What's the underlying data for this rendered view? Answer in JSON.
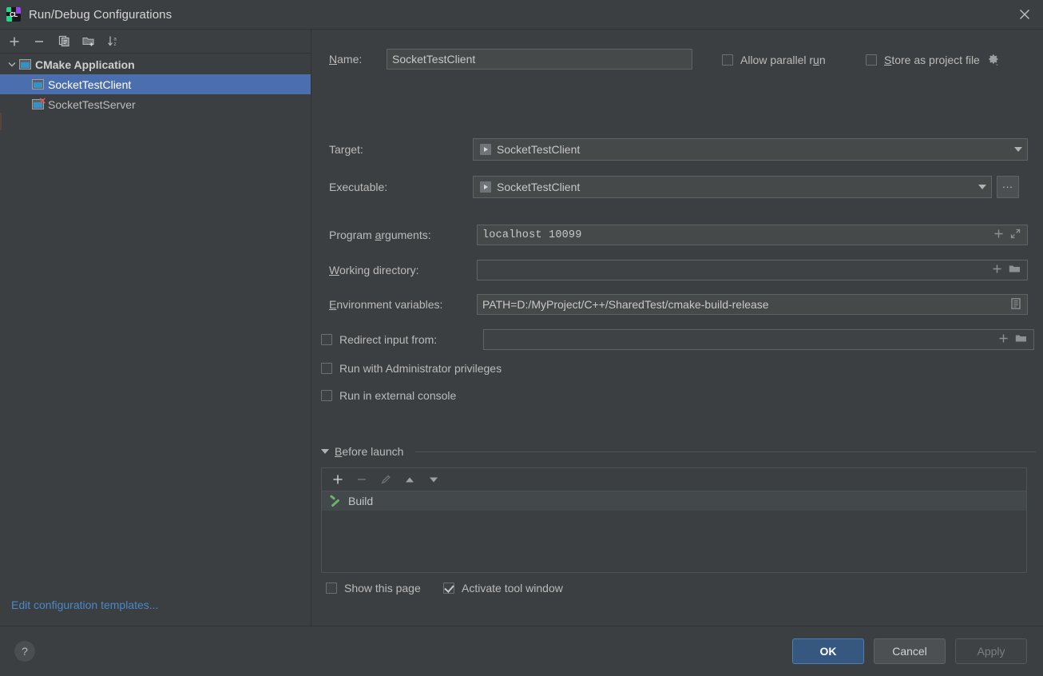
{
  "window": {
    "title": "Run/Debug Configurations",
    "logo_icon": "clion-logo-icon",
    "logo_text": "CL",
    "close_icon": "close-icon"
  },
  "sidebar": {
    "toolbar": [
      {
        "name": "add-configuration-button",
        "icon": "plus-icon"
      },
      {
        "name": "remove-configuration-button",
        "icon": "minus-icon"
      },
      {
        "name": "copy-configuration-button",
        "icon": "copy-icon"
      },
      {
        "name": "new-folder-button",
        "icon": "new-folder-icon"
      },
      {
        "name": "sort-configurations-button",
        "icon": "sort-alpha-icon"
      }
    ],
    "group": {
      "label": "CMake Application",
      "expanded": true,
      "caret_icon": "chevron-down-icon",
      "icon": "cmake-application-icon"
    },
    "items": [
      {
        "label": "SocketTestClient",
        "selected": true,
        "error": false,
        "icon": "run-configuration-icon"
      },
      {
        "label": "SocketTestServer",
        "selected": false,
        "error": true,
        "icon": "run-configuration-error-icon"
      }
    ],
    "edit_templates_link": "Edit configuration templates..."
  },
  "form": {
    "name_label": "Name:",
    "name_label_mnemonic": "N",
    "name_value": "SocketTestClient",
    "allow_parallel_run": {
      "label": "Allow parallel run",
      "checked": false,
      "mnemonic": "u"
    },
    "store_as_project_file": {
      "label": "Store as project file",
      "checked": false,
      "mnemonic": "S",
      "gear_icon": "gear-dropdown-icon"
    },
    "target_label": "Target:",
    "target_value": "SocketTestClient",
    "target_icon": "run-target-icon",
    "executable_label": "Executable:",
    "executable_value": "SocketTestClient",
    "executable_icon": "run-target-icon",
    "executable_browse_label": "...",
    "program_arguments_label": "Program arguments:",
    "program_arguments_mnemonic": "a",
    "program_arguments_value": "localhost 10099",
    "program_arguments_icons": [
      "insert-macro-icon",
      "expand-editor-icon"
    ],
    "working_directory_label": "Working directory:",
    "working_directory_mnemonic": "W",
    "working_directory_value": "",
    "working_directory_icons": [
      "insert-macro-icon",
      "browse-folder-icon"
    ],
    "environment_variables_label": "Environment variables:",
    "environment_variables_mnemonic": "E",
    "environment_variables_value": "PATH=D:/MyProject/C++/SharedTest/cmake-build-release",
    "environment_variables_icon": "edit-environment-variables-icon",
    "redirect_input": {
      "label": "Redirect input from:",
      "checked": false,
      "value": "",
      "icons": [
        "insert-macro-icon",
        "browse-folder-icon"
      ]
    },
    "run_as_administrator": {
      "label": "Run with Administrator privileges",
      "checked": false
    },
    "run_external_console": {
      "label": "Run in external console",
      "checked": false
    }
  },
  "before_launch": {
    "title": "Before launch",
    "mnemonic": "B",
    "expanded": true,
    "caret_icon": "triangle-down-icon",
    "toolbar": [
      {
        "name": "add-task-button",
        "icon": "plus-icon",
        "enabled": true
      },
      {
        "name": "remove-task-button",
        "icon": "minus-icon",
        "enabled": false
      },
      {
        "name": "edit-task-button",
        "icon": "pencil-icon",
        "enabled": false
      },
      {
        "name": "move-task-up-button",
        "icon": "arrow-up-icon",
        "enabled": true
      },
      {
        "name": "move-task-down-button",
        "icon": "arrow-down-icon",
        "enabled": true
      }
    ],
    "tasks": [
      {
        "label": "Build",
        "icon": "build-hammer-icon"
      }
    ],
    "show_this_page": {
      "label": "Show this page",
      "checked": false
    },
    "activate_tool_window": {
      "label": "Activate tool window",
      "checked": true
    }
  },
  "footer": {
    "help_icon": "help-icon",
    "help_label": "?",
    "ok_label": "OK",
    "cancel_label": "Cancel",
    "apply_label": "Apply",
    "apply_enabled": false
  },
  "colors": {
    "background": "#3c3f41",
    "selection": "#4b6eaf",
    "link": "#4a88c7",
    "primary_button": "#365880",
    "error": "#e05555",
    "build_icon": "#6cb36c"
  }
}
